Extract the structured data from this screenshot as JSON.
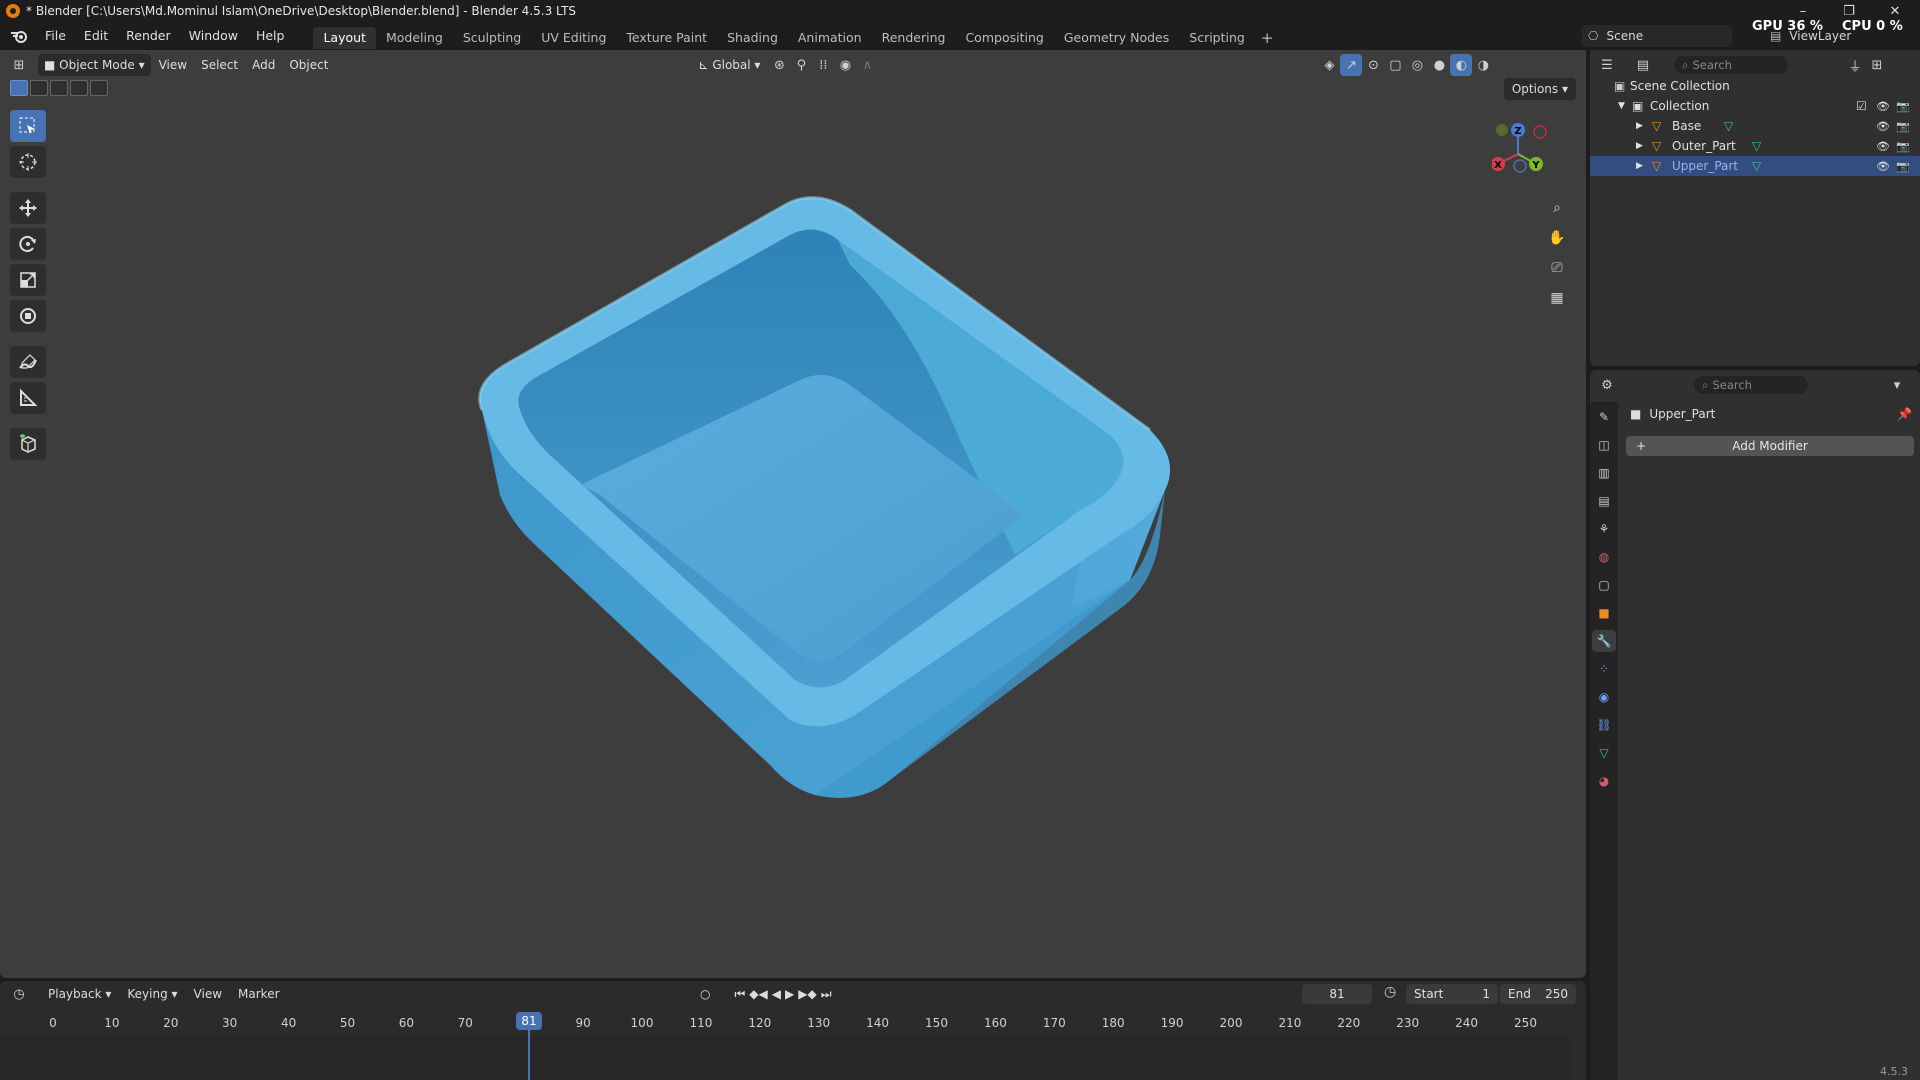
{
  "window": {
    "title": "* Blender [C:\\Users\\Md.Mominul Islam\\OneDrive\\Desktop\\Blender.blend] - Blender 4.5.3 LTS",
    "minimize": "–",
    "maximize": "❐",
    "close": "✕"
  },
  "menu": {
    "file": "File",
    "edit": "Edit",
    "render": "Render",
    "window": "Window",
    "help": "Help"
  },
  "workspaces": [
    "Layout",
    "Modeling",
    "Sculpting",
    "UV Editing",
    "Texture Paint",
    "Shading",
    "Animation",
    "Rendering",
    "Compositing",
    "Geometry Nodes",
    "Scripting"
  ],
  "workspace_add": "+",
  "scene": {
    "label": "Scene",
    "view_layer": "ViewLayer"
  },
  "perf": {
    "gpu": "GPU 36 %",
    "cpu": "CPU 0 %"
  },
  "viewport_header": {
    "mode": "Object Mode",
    "view": "View",
    "select": "Select",
    "add": "Add",
    "object": "Object",
    "orientation": "Global",
    "options": "Options"
  },
  "gizmo": {
    "z": "Z",
    "x": "X",
    "y": "Y"
  },
  "timeline": {
    "playback": "Playback",
    "keying": "Keying",
    "view": "View",
    "marker": "Marker",
    "current_frame": "81",
    "start_label": "Start",
    "start": "1",
    "end_label": "End",
    "end": "250",
    "ticks": [
      "0",
      "10",
      "20",
      "30",
      "40",
      "50",
      "60",
      "70",
      "81",
      "90",
      "100",
      "110",
      "120",
      "130",
      "140",
      "150",
      "160",
      "170",
      "180",
      "190",
      "200",
      "210",
      "220",
      "230",
      "240",
      "250"
    ]
  },
  "outliner": {
    "search_placeholder": "Search",
    "scene_collection": "Scene Collection",
    "collection": "Collection",
    "objects": [
      "Base",
      "Outer_Part",
      "Upper_Part"
    ]
  },
  "properties": {
    "search_placeholder": "Search",
    "object_name": "Upper_Part",
    "add_modifier": "Add Modifier",
    "add_modifier_icon": "+"
  },
  "version": "4.5.3",
  "colors": {
    "accent": "#4772b3",
    "object_blue": "#5aaedc",
    "selected_row": "#334d80",
    "mesh_orange": "#e98c28",
    "data_green": "#2fc48f"
  }
}
